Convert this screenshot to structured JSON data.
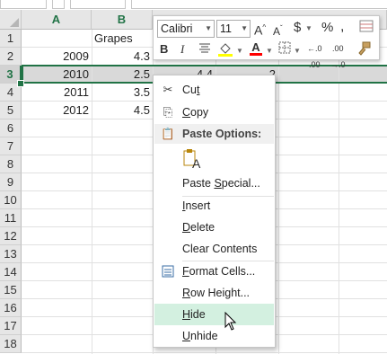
{
  "columns": [
    "A",
    "B"
  ],
  "rows": [
    "1",
    "2",
    "3",
    "4",
    "5",
    "6",
    "7",
    "8",
    "9",
    "10",
    "11",
    "12",
    "13",
    "14",
    "15",
    "16",
    "17",
    "18"
  ],
  "selected_row": "3",
  "cells": {
    "b1": "Grapes",
    "a2": "2009",
    "b2": "4.3",
    "a3": "2010",
    "b3": "2.5",
    "c3": "4.4",
    "d3": "2",
    "a4": "2011",
    "b4": "3.5",
    "a5": "2012",
    "b5": "4.5"
  },
  "mini_toolbar": {
    "font_name": "Calibri",
    "font_size": "11",
    "bold": "B",
    "italic": "I",
    "percent": "%",
    "currency": "$",
    "comma": ",",
    "font_color_letter": "A",
    "grow_font": "A",
    "shrink_font": "A",
    "highlight_color": "#ffff00",
    "font_color": "#ff0000"
  },
  "context_menu": {
    "cut": "Cut",
    "copy": "Copy",
    "paste_options": "Paste Options:",
    "paste_special": "Paste Special...",
    "insert": "Insert",
    "delete": "Delete",
    "clear_contents": "Clear Contents",
    "format_cells": "Format Cells...",
    "row_height": "Row Height...",
    "hide": "Hide",
    "unhide": "Unhide"
  },
  "colors": {
    "excel_green": "#217346",
    "menu_highlight": "#d3f0e0"
  }
}
